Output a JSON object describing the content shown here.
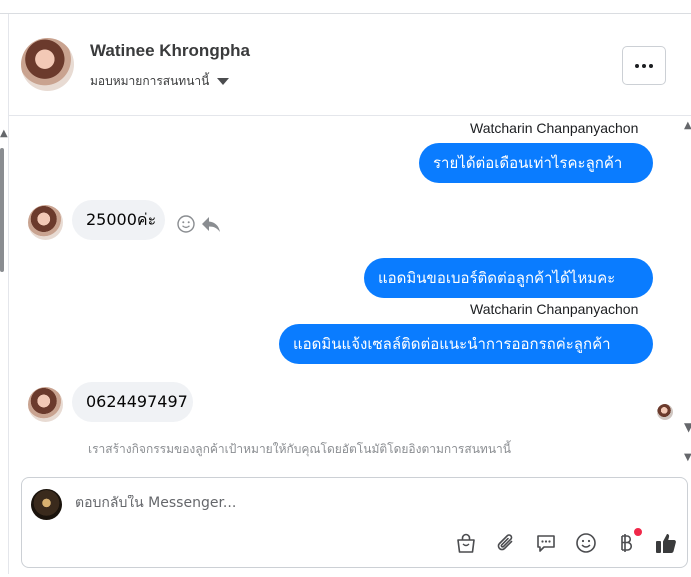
{
  "header": {
    "customer_name": "Watinee Khrongpha",
    "assign_label": "มอบหมายการสนทนานี้"
  },
  "messages": [
    {
      "sender": "Watcharin Chanpanyachon",
      "text": "รายได้ต่อเดือนเท่าไรคะลูกค้า",
      "direction": "out"
    },
    {
      "text": "25000ค่ะ",
      "direction": "in"
    },
    {
      "text": "แอดมินขอเบอร์ติดต่อลูกค้าได้ไหมคะ",
      "direction": "out"
    },
    {
      "sender": "Watcharin Chanpanyachon",
      "text": "แอดมินแจ้งเซลล์ติดต่อแนะนำการออกรถค่ะลูกค้า",
      "direction": "out"
    },
    {
      "text": "0624497497",
      "direction": "in"
    }
  ],
  "notice": "เราสร้างกิจกรรมของลูกค้าเป้าหมายให้กับคุณโดยอัตโนมัติโดยอิงตามการสนทนานี้",
  "composer": {
    "placeholder": "ตอบกลับใน Messenger..."
  },
  "tool_icons": [
    "shopping-bag-icon",
    "paperclip-icon",
    "saved-reply-icon",
    "emoji-icon",
    "baht-payment-icon",
    "thumbs-up-icon"
  ],
  "colors": {
    "outgoing_bubble": "#0a7cff",
    "incoming_bubble": "#f0f2f5",
    "notification_dot": "#f02849"
  }
}
